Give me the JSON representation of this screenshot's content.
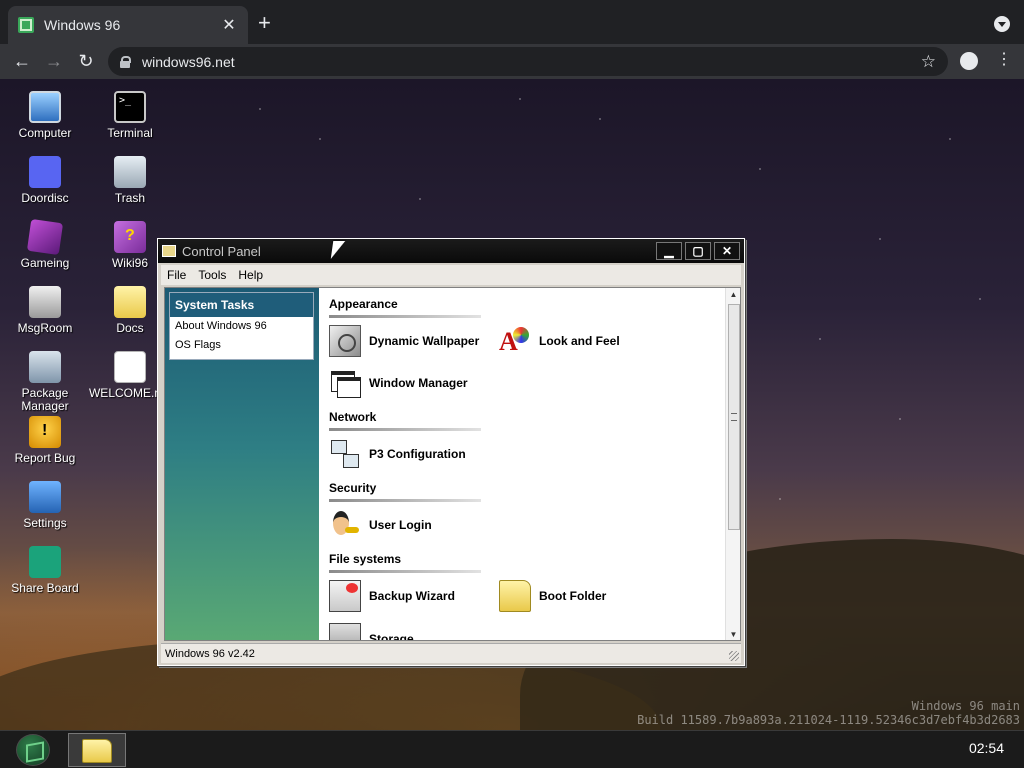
{
  "browser": {
    "tab_title": "Windows 96",
    "tab_close": "✕",
    "new_tab": "+",
    "url": "windows96.net",
    "back": "←",
    "forward": "→",
    "reload": "↻",
    "bookmark": "☆",
    "menu": "⋮"
  },
  "desktop": {
    "icons": [
      {
        "label": "Computer",
        "icon": "computer-icon"
      },
      {
        "label": "Terminal",
        "icon": "terminal-icon"
      },
      {
        "label": "Doordisc",
        "icon": "discord-icon"
      },
      {
        "label": "Trash",
        "icon": "trash-icon"
      },
      {
        "label": "Gameing",
        "icon": "game-cube-icon"
      },
      {
        "label": "Wiki96",
        "icon": "wiki-book-icon"
      },
      {
        "label": "MsgRoom",
        "icon": "message-room-icon"
      },
      {
        "label": "Docs",
        "icon": "folder-icon"
      },
      {
        "label": "Package Manager",
        "icon": "package-icon"
      },
      {
        "label": "WELCOME.md",
        "icon": "document-icon"
      },
      {
        "label": "Report Bug",
        "icon": "warning-shield-icon"
      },
      {
        "label": "Settings",
        "icon": "settings-icon"
      },
      {
        "label": "Share Board",
        "icon": "share-icon"
      }
    ],
    "build_line1": "Windows 96 main",
    "build_line2": "Build 11589.7b9a893a.211024-1119.52346c3d7ebf4b3d2683"
  },
  "window": {
    "title": "Control Panel",
    "minimize": "▁",
    "maximize": "▢",
    "close": "✕",
    "menu": [
      "File",
      "Tools",
      "Help"
    ],
    "tasks": {
      "heading": "System Tasks",
      "links": [
        "About Windows 96",
        "OS Flags"
      ]
    },
    "sections": [
      {
        "title": "Appearance"
      },
      {
        "title": "Network"
      },
      {
        "title": "Security"
      },
      {
        "title": "File systems"
      }
    ],
    "items": {
      "dynamic_wallpaper": "Dynamic Wallpaper",
      "look_and_feel": "Look and Feel",
      "window_manager": "Window Manager",
      "p3_configuration": "P3 Configuration",
      "user_login": "User Login",
      "backup_wizard": "Backup Wizard",
      "boot_folder": "Boot Folder",
      "storage": "Storage"
    },
    "status": "Windows 96 v2.42"
  },
  "taskbar": {
    "clock": "02:54"
  }
}
